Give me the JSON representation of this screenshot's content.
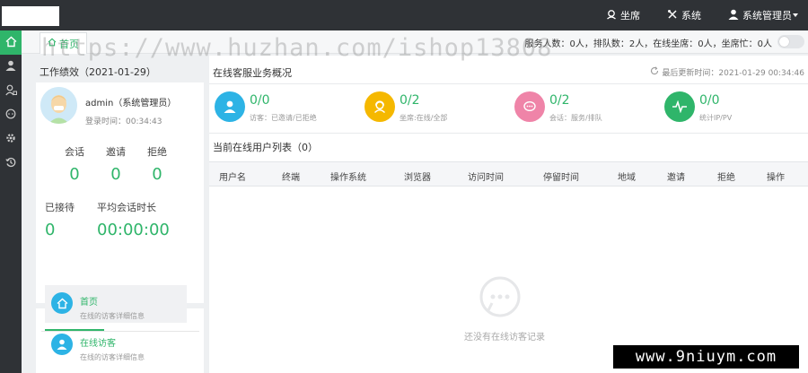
{
  "topnav": {
    "agent_label": "坐席",
    "system_label": "系统",
    "admin_label": "系统管理员"
  },
  "tabs": {
    "home_label": "首页"
  },
  "status_line": "服务人数：0人，排队数：2人，在线坐席：0人，坐席忙：0人",
  "watermark": "https://www.huzhan.com/ishop13808",
  "watermark2": "www.9niuym.com",
  "performance": {
    "title": "工作绩效（2021-01-29）",
    "admin_name": "admin（系统管理员）",
    "login_time": "登录时间：00:34:43",
    "stats": {
      "session_label": "会话",
      "session_value": "0",
      "invite_label": "邀请",
      "invite_value": "0",
      "reject_label": "拒绝",
      "reject_value": "0",
      "received_label": "已接待",
      "received_value": "0",
      "avg_label": "平均会话时长",
      "avg_value": "00:00:00"
    }
  },
  "tools": {
    "items": [
      {
        "title": "首页",
        "desc": "在线的访客详细信息"
      },
      {
        "title": "在线访客",
        "desc": "在线的访客详细信息"
      }
    ]
  },
  "overview": {
    "title": "在线客服业务概况",
    "updated": "最后更新时间：2021-01-29 00:34:46",
    "metrics": [
      {
        "value": "0/0",
        "label": "访客：已邀请/已拒绝",
        "color": "#2db3e5"
      },
      {
        "value": "0/2",
        "label": "坐席:在线/全部",
        "color": "#f5b800"
      },
      {
        "value": "0/2",
        "label": "会话：服务/排队",
        "color": "#ef84a8"
      },
      {
        "value": "0/0",
        "label": "统计IP/PV",
        "color": "#2fb56a"
      }
    ]
  },
  "online_users": {
    "title": "当前在线用户列表（0）",
    "columns": [
      "用户名",
      "终端",
      "操作系统",
      "浏览器",
      "访问时间",
      "停留时间",
      "地域",
      "邀请",
      "拒绝",
      "操作"
    ],
    "empty_text": "还没有在线访客记录"
  }
}
